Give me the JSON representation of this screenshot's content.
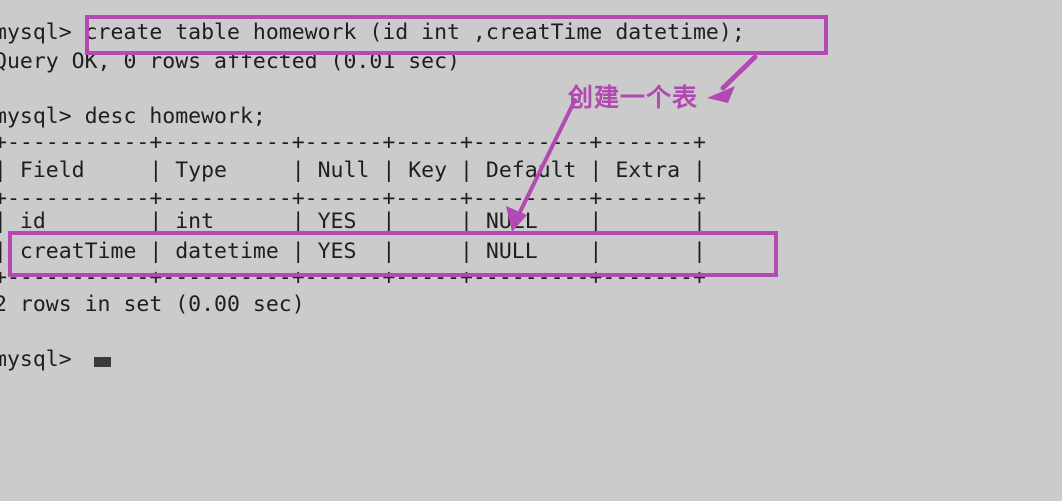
{
  "theme": {
    "background": "#cbcbcb",
    "text_color": "#1e1e1e",
    "annotation_color": "#b349b3"
  },
  "terminal": {
    "lines": [
      {
        "id": "l1",
        "text": "mysql> create table homework (id int ,creatTime datetime);"
      },
      {
        "id": "l2",
        "text": "Query OK, 0 rows affected (0.01 sec)"
      },
      {
        "id": "l3",
        "text": ""
      },
      {
        "id": "l4",
        "text": "mysql> desc homework;"
      },
      {
        "id": "l5",
        "text": "+-----------+----------+------+-----+---------+-------+"
      },
      {
        "id": "l6",
        "text": "| Field     | Type     | Null | Key | Default | Extra |"
      },
      {
        "id": "l7",
        "text": "+-----------+----------+------+-----+---------+-------+"
      },
      {
        "id": "l8",
        "text": "| id        | int      | YES  |     | NULL    |       |"
      },
      {
        "id": "l9",
        "text": "| creatTime | datetime | YES  |     | NULL    |       |"
      },
      {
        "id": "l10",
        "text": "+-----------+----------+------+-----+---------+-------+"
      },
      {
        "id": "l11",
        "text": "2 rows in set (0.00 sec)"
      },
      {
        "id": "l12",
        "text": ""
      },
      {
        "id": "l13",
        "text": "mysql> "
      }
    ],
    "prompt": "mysql>",
    "command_1": "create table homework (id int ,creatTime datetime);",
    "command_1_result": "Query OK, 0 rows affected (0.01 sec)",
    "command_2": "desc homework;",
    "command_2_result": "2 rows in set (0.00 sec)"
  },
  "result_table": {
    "columns": [
      "Field",
      "Type",
      "Null",
      "Key",
      "Default",
      "Extra"
    ],
    "rows": [
      {
        "Field": "id",
        "Type": "int",
        "Null": "YES",
        "Key": "",
        "Default": "NULL",
        "Extra": ""
      },
      {
        "Field": "creatTime",
        "Type": "datetime",
        "Null": "YES",
        "Key": "",
        "Default": "NULL",
        "Extra": ""
      }
    ],
    "row_count_text": "2 rows in set (0.00 sec)"
  },
  "annotations": {
    "highlight_create_statement": {
      "target_text": "create table homework (id int ,creatTime datetime);",
      "color": "#b349b3"
    },
    "highlight_creattime_row": {
      "target_text": "creatTime | datetime | YES |  | NULL |  |",
      "color": "#b349b3"
    },
    "note_label": "创建一个表",
    "note_color": "#b049b0"
  }
}
